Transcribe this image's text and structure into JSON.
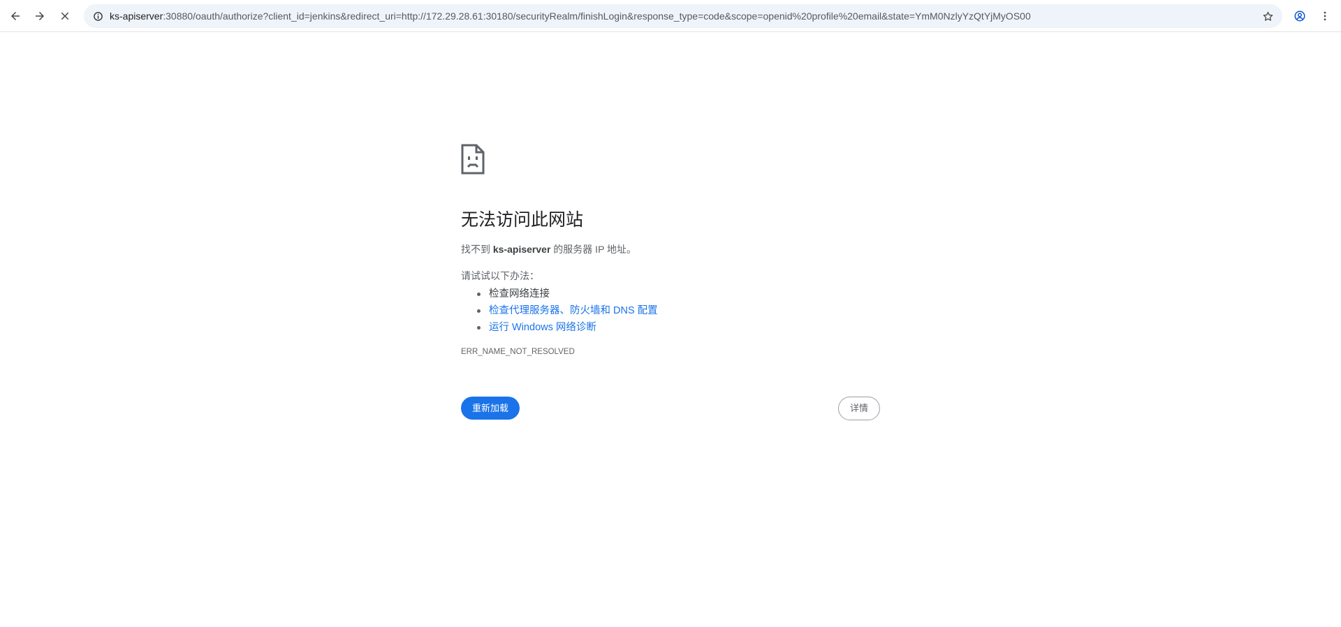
{
  "toolbar": {
    "back_icon": "arrow-left-icon",
    "forward_icon": "arrow-right-icon",
    "stop_icon": "close-icon",
    "profile_icon": "account-circle-icon",
    "menu_icon": "more-vertical-icon"
  },
  "omnibox": {
    "info_icon": "info-icon",
    "url_host": "ks-apiserver",
    "url_rest": ":30880/oauth/authorize?client_id=jenkins&redirect_uri=http://172.29.28.61:30180/securityRealm/finishLogin&response_type=code&scope=openid%20profile%20email&state=YmM0NzlyYzQtYjMyOS00",
    "bookmark_icon": "star-icon"
  },
  "error_page": {
    "icon": "sad-page-icon",
    "title": "无法访问此网站",
    "desc_prefix": "找不到 ",
    "desc_host": "ks-apiserver",
    "desc_suffix": " 的服务器 IP 地址。",
    "try_heading": "请试试以下办法：",
    "suggestions": [
      "检查网络连接",
      "检查代理服务器、防火墙和 DNS 配置",
      "运行 Windows 网络诊断"
    ],
    "error_code": "ERR_NAME_NOT_RESOLVED",
    "reload_label": "重新加载",
    "details_label": "详情"
  },
  "colors": {
    "accent": "#1a73e8",
    "omnibox_bg": "#eff3fa",
    "text_secondary": "#5f6368"
  }
}
